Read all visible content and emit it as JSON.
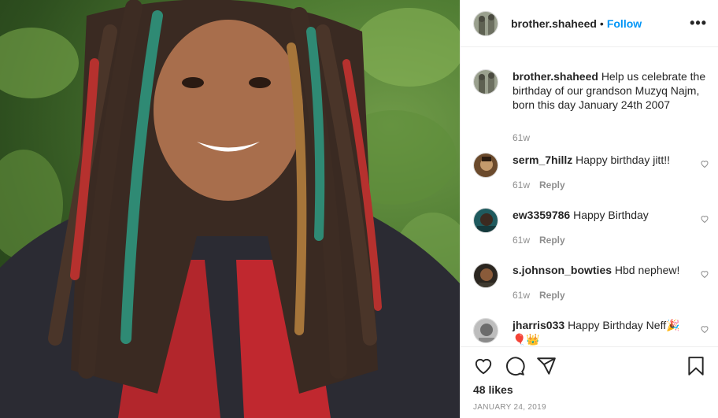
{
  "post": {
    "username": "brother.shaheed",
    "follow_label": "Follow",
    "separator": "•",
    "more_label": "•••"
  },
  "caption": {
    "username": "brother.shaheed",
    "text": "Help us celebrate the birthday of our grandson Muzyq Najm, born this day January 24th 2007",
    "time": "61w"
  },
  "comments": [
    {
      "username": "serm_7hillz",
      "text": "Happy birthday jitt!!",
      "time": "61w",
      "reply": "Reply"
    },
    {
      "username": "ew3359786",
      "text": "Happy Birthday",
      "time": "61w",
      "reply": "Reply"
    },
    {
      "username": "s.johnson_bowties",
      "text": "Hbd nephew!",
      "time": "61w",
      "reply": "Reply"
    },
    {
      "username": "jharris033",
      "text": "Happy Birthday Neff🎉🎈👑",
      "time": "",
      "reply": ""
    }
  ],
  "likes": "48 likes",
  "date": "JANUARY 24, 2019",
  "icons": [
    "heart-icon",
    "comment-icon",
    "share-icon",
    "bookmark-icon",
    "more-options-icon"
  ]
}
